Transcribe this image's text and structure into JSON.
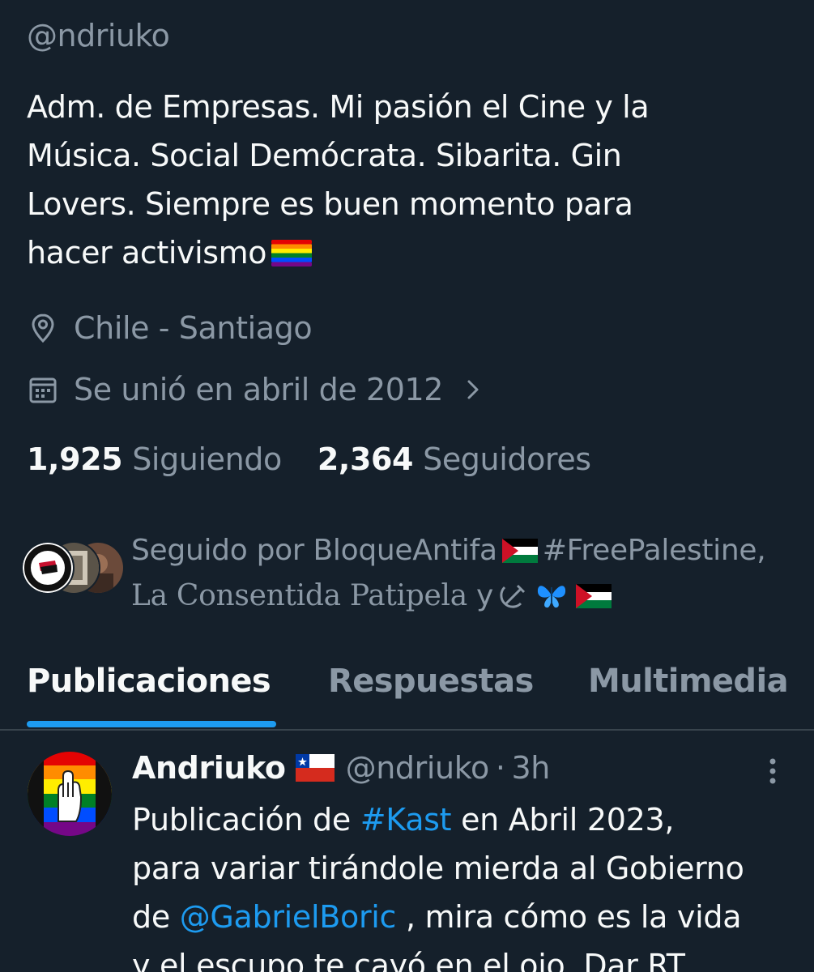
{
  "profile": {
    "handle": "@ndriuko",
    "bio_lines": [
      "Adm. de Empresas. Mi pasión el Cine y la",
      "Música. Social Demócrata. Sibarita. Gin",
      "Lovers. Siempre es buen momento para",
      "hacer activismo"
    ],
    "bio_emoji": "rainbow-flag-icon",
    "location": "Chile - Santiago",
    "joined": "Se unió en abril de 2012",
    "following_count": "1,925",
    "following_label": "Siguiendo",
    "followers_count": "2,364",
    "followers_label": "Seguidores",
    "followed_by": {
      "line1": "Seguido por BloqueAntifa",
      "line1_tag": "#FreePalestine,",
      "line2_name": "La Consentida Patipela",
      "line2_and": "y"
    }
  },
  "tabs": [
    {
      "label": "Publicaciones",
      "active": true
    },
    {
      "label": "Respuestas",
      "active": false
    },
    {
      "label": "Multimedia",
      "active": false
    }
  ],
  "tweet": {
    "author_name": "Andriuko",
    "author_handle": "@ndriuko",
    "separator": "·",
    "time": "3h",
    "line1_pre": "Publicación de",
    "line1_tag": "#Kast",
    "line1_post": "en Abril 2023,",
    "line2": "para variar tirándole mierda al Gobierno",
    "line3_pre": "de",
    "line3_mention": "@GabrielBoric",
    "line3_post": ", mira cómo es la vida",
    "line4": "y el escupo te cayó en el ojo. Dar RT"
  },
  "colors": {
    "background": "#15202b",
    "text_primary": "#f7f9f9",
    "text_secondary": "#8b98a5",
    "accent": "#1d9bf0",
    "divider": "#38444d"
  }
}
